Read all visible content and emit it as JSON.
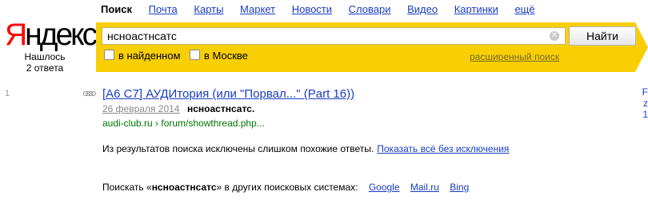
{
  "nav": {
    "active": "Поиск",
    "items": [
      "Почта",
      "Карты",
      "Маркет",
      "Новости",
      "Словари",
      "Видео",
      "Картинки"
    ],
    "more": "ещё"
  },
  "logo": {
    "first": "Я",
    "rest": "ндекс"
  },
  "found": {
    "line1": "Нашлось",
    "line2": "2 ответа"
  },
  "search": {
    "query": "нсноастнсатс",
    "button": "Найти",
    "option1": "в найденном",
    "option2": "в Москве",
    "advanced": "расширенный поиск"
  },
  "result": {
    "number": "1",
    "title": "[A6 C7] АУДИтория (или \"Порвал...\" (Part 16))",
    "date": "26 февраля 2014",
    "snippet": "нсноастнсатс.",
    "url": "audi-club.ru › forum/showthread.php..."
  },
  "exclusion": {
    "text": "Из результатов поиска исключены слишком похожие ответы.",
    "link": "Показать всё без исключения"
  },
  "other": {
    "prefix": "Поискать «",
    "query": "нсноастнсатс",
    "suffix": "» в других поисковых системах:",
    "engines": [
      "Google",
      "Mail.ru",
      "Bing"
    ]
  },
  "colors": {
    "band": "#f8cf05",
    "link": "#1a3dc1",
    "url": "#007700",
    "logo_red": "#ff0000"
  }
}
